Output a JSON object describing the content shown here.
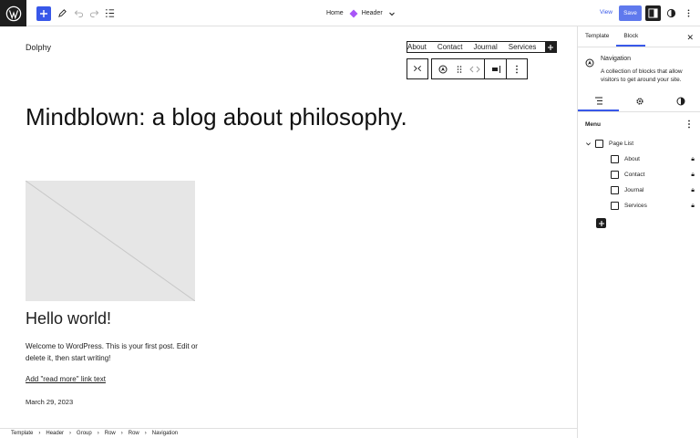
{
  "topbar": {
    "home_label": "Home",
    "template_name": "Header",
    "view_label": "View",
    "save_label": "Save"
  },
  "canvas": {
    "site_title": "Dolphy",
    "nav_items": [
      "About",
      "Contact",
      "Journal",
      "Services"
    ],
    "post_title": "Mindblown: a blog about philosophy.",
    "post_heading": "Hello world!",
    "excerpt": "Welcome to WordPress. This is your first post. Edit or delete it, then start writing!",
    "read_more": "Add \"read more\" link text",
    "date": "March 29, 2023"
  },
  "breadcrumb": [
    "Template",
    "Header",
    "Group",
    "Row",
    "Row",
    "Navigation"
  ],
  "sidebar": {
    "tabs": [
      "Template",
      "Block"
    ],
    "block_title": "Navigation",
    "block_description": "A collection of blocks that allow visitors to get around your site.",
    "menu_heading": "Menu",
    "page_list_label": "Page List",
    "pages": [
      "About",
      "Contact",
      "Journal",
      "Services"
    ]
  },
  "colors": {
    "accent": "#3858e9",
    "dark": "#1e1e1e"
  }
}
